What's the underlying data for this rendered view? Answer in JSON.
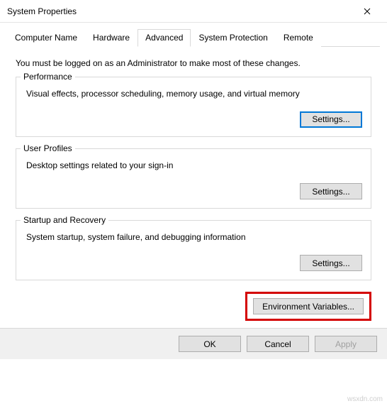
{
  "window": {
    "title": "System Properties",
    "close_icon": "close"
  },
  "tabs": {
    "computer_name": "Computer Name",
    "hardware": "Hardware",
    "advanced": "Advanced",
    "system_protection": "System Protection",
    "remote": "Remote",
    "active_index": 2
  },
  "advanced": {
    "admin_note": "You must be logged on as an Administrator to make most of these changes.",
    "performance": {
      "legend": "Performance",
      "desc": "Visual effects, processor scheduling, memory usage, and virtual memory",
      "settings_label": "Settings..."
    },
    "user_profiles": {
      "legend": "User Profiles",
      "desc": "Desktop settings related to your sign-in",
      "settings_label": "Settings..."
    },
    "startup_recovery": {
      "legend": "Startup and Recovery",
      "desc": "System startup, system failure, and debugging information",
      "settings_label": "Settings..."
    },
    "env_vars_label": "Environment Variables..."
  },
  "footer": {
    "ok": "OK",
    "cancel": "Cancel",
    "apply": "Apply"
  },
  "watermark": "wsxdn.com"
}
